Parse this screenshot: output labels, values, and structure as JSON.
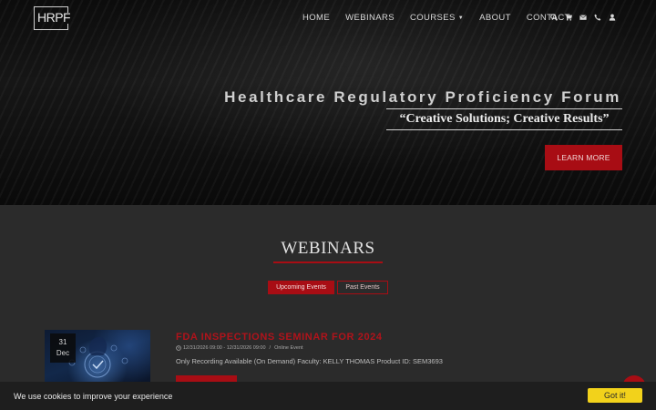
{
  "header": {
    "logo_text": "HRPF",
    "nav": [
      {
        "label": "HOME"
      },
      {
        "label": "WEBINARS"
      },
      {
        "label": "COURSES"
      },
      {
        "label": "ABOUT"
      },
      {
        "label": "CONTACT"
      }
    ],
    "icons": [
      "search-icon",
      "cart-icon",
      "envelope-icon",
      "phone-icon",
      "user-icon"
    ]
  },
  "hero": {
    "title": "Healthcare Regulatory Proficiency Forum",
    "subtitle": "“Creative Solutions; Creative Results”",
    "cta_label": "LEARN MORE"
  },
  "webinars": {
    "heading": "WEBINARS",
    "tabs": [
      {
        "label": "Upcoming Events",
        "active": true
      },
      {
        "label": "Past Events",
        "active": false
      }
    ],
    "event": {
      "date_day": "31",
      "date_month": "Dec",
      "title": "FDA INSPECTIONS SEMINAR FOR 2024",
      "datetime": "12/31/2026 09:00 - 12/31/2026 09:00",
      "location": "Online Event",
      "description": "Only Recording Available (On Demand) Faculty: KELLY THOMAS Product ID: SEM3693"
    }
  },
  "cookie": {
    "message": "We use cookies to improve your experience",
    "button_label": "Got it!"
  },
  "colors": {
    "accent": "#a80d14",
    "cookie_button": "#f2d21b",
    "background": "#2b2b2b"
  }
}
